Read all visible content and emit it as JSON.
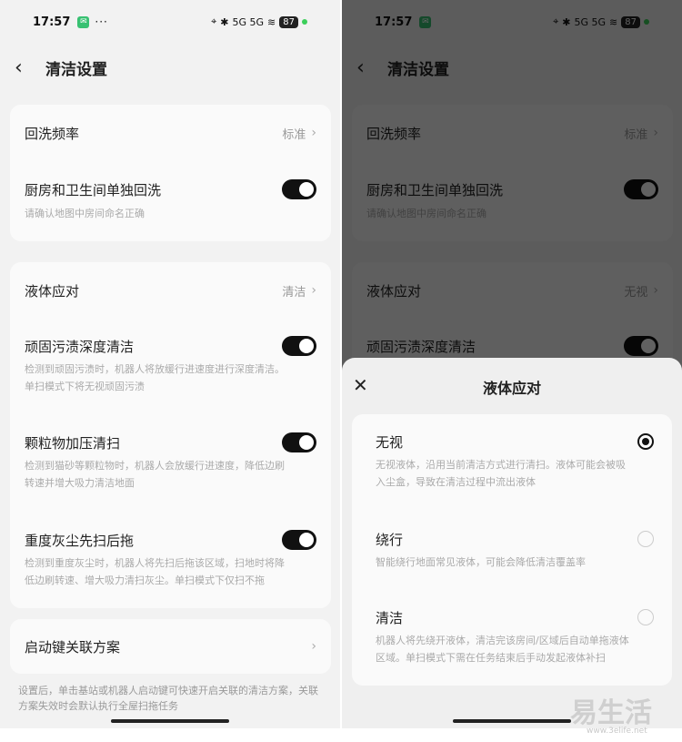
{
  "status": {
    "time": "17:57",
    "dots": "···",
    "battery": "87",
    "network": "5G 5G"
  },
  "nav": {
    "title": "清洁设置"
  },
  "card1": {
    "row1": {
      "label": "回洗频率",
      "value": "标准"
    },
    "row2": {
      "label": "厨房和卫生间单独回洗",
      "desc": "请确认地图中房间命名正确"
    }
  },
  "card2": {
    "row1": {
      "label": "液体应对",
      "value_left": "清洁",
      "value_right": "无视"
    },
    "row2": {
      "label": "顽固污渍深度清洁",
      "desc1": "检测到顽固污渍时，机器人将放缓行进速度进行深度清洁。",
      "desc2": "单扫模式下将无视顽固污渍"
    },
    "row3": {
      "label": "颗粒物加压清扫",
      "desc1": "检测到猫砂等颗粒物时，机器人会放缓行进速度，降低边刷",
      "desc2": "转速并增大吸力清洁地面"
    },
    "row4": {
      "label": "重度灰尘先扫后拖",
      "desc1": "检测到重度灰尘时，机器人将先扫后拖该区域，扫地时将降",
      "desc2": "低边刷转速、增大吸力清扫灰尘。单扫模式下仅扫不拖"
    }
  },
  "card3": {
    "label": "启动键关联方案"
  },
  "footer": {
    "line1": "设置后，单击基站或机器人启动键可快速开启关联的清洁方案，关联",
    "line2": "方案失效时会默认执行全屋扫拖任务"
  },
  "sheet": {
    "title": "液体应对",
    "options": [
      {
        "title": "无视",
        "desc1": "无视液体，沿用当前清洁方式进行清扫。液体可能会被吸",
        "desc2": "入尘盒，导致在清洁过程中流出液体",
        "selected": true
      },
      {
        "title": "绕行",
        "desc1": "智能绕行地面常见液体，可能会降低清洁覆盖率",
        "desc2": "",
        "selected": false
      },
      {
        "title": "清洁",
        "desc1": "机器人将先绕开液体，清洁完该房间/区域后自动单拖液体",
        "desc2": "区域。单扫模式下需在任务结束后手动发起液体补扫",
        "selected": false
      }
    ]
  },
  "watermark": {
    "text": "易生活",
    "url": "www.3elife.net"
  }
}
